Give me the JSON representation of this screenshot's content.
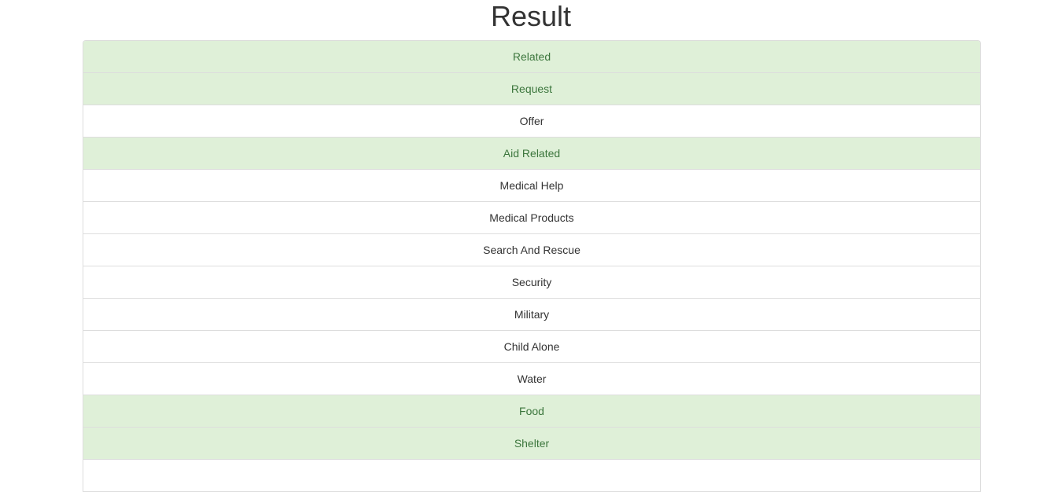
{
  "page": {
    "title": "Result"
  },
  "results": [
    {
      "label": "Related",
      "positive": true
    },
    {
      "label": "Request",
      "positive": true
    },
    {
      "label": "Offer",
      "positive": false
    },
    {
      "label": "Aid Related",
      "positive": true
    },
    {
      "label": "Medical Help",
      "positive": false
    },
    {
      "label": "Medical Products",
      "positive": false
    },
    {
      "label": "Search And Rescue",
      "positive": false
    },
    {
      "label": "Security",
      "positive": false
    },
    {
      "label": "Military",
      "positive": false
    },
    {
      "label": "Child Alone",
      "positive": false
    },
    {
      "label": "Water",
      "positive": false
    },
    {
      "label": "Food",
      "positive": true
    },
    {
      "label": "Shelter",
      "positive": true
    },
    {
      "label": "",
      "positive": false
    }
  ],
  "colors": {
    "positive_background": "#dff0d8",
    "positive_text": "#3c763d",
    "default_text": "#333333",
    "border": "#dddddd"
  }
}
